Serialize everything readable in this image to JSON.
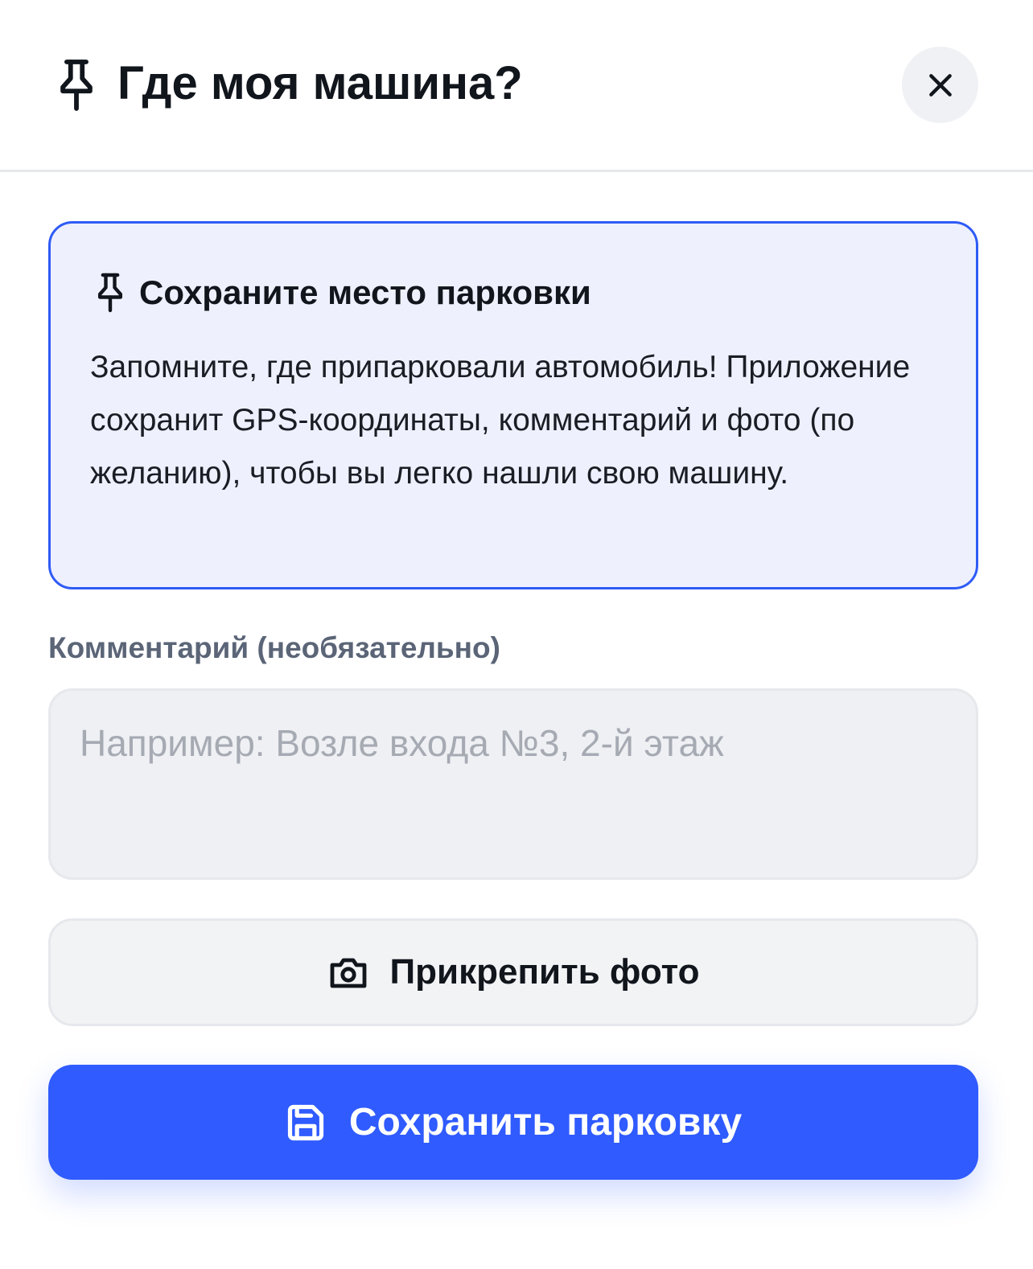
{
  "header": {
    "title": "Где моя машина?",
    "icon": "pin-icon",
    "close_icon": "close-icon"
  },
  "info_card": {
    "icon": "pin-icon",
    "title": "Сохраните место парковки",
    "text": "Запомните, где припарковали автомобиль! Приложение сохранит GPS-координаты, комментарий и фото (по желанию), чтобы вы легко нашли свою машину."
  },
  "comment": {
    "label": "Комментарий (необязательно)",
    "placeholder": "Например: Возле входа №3, 2-й этаж",
    "value": ""
  },
  "photo_button": {
    "icon": "camera-icon",
    "label": "Прикрепить фото"
  },
  "save_button": {
    "icon": "save-icon",
    "label": "Сохранить парковку"
  },
  "colors": {
    "accent": "#2f5bff",
    "card_background": "#eef1fd",
    "card_border": "#2f5bf5",
    "label_color": "#5b6577",
    "input_background": "#eff0f3"
  }
}
